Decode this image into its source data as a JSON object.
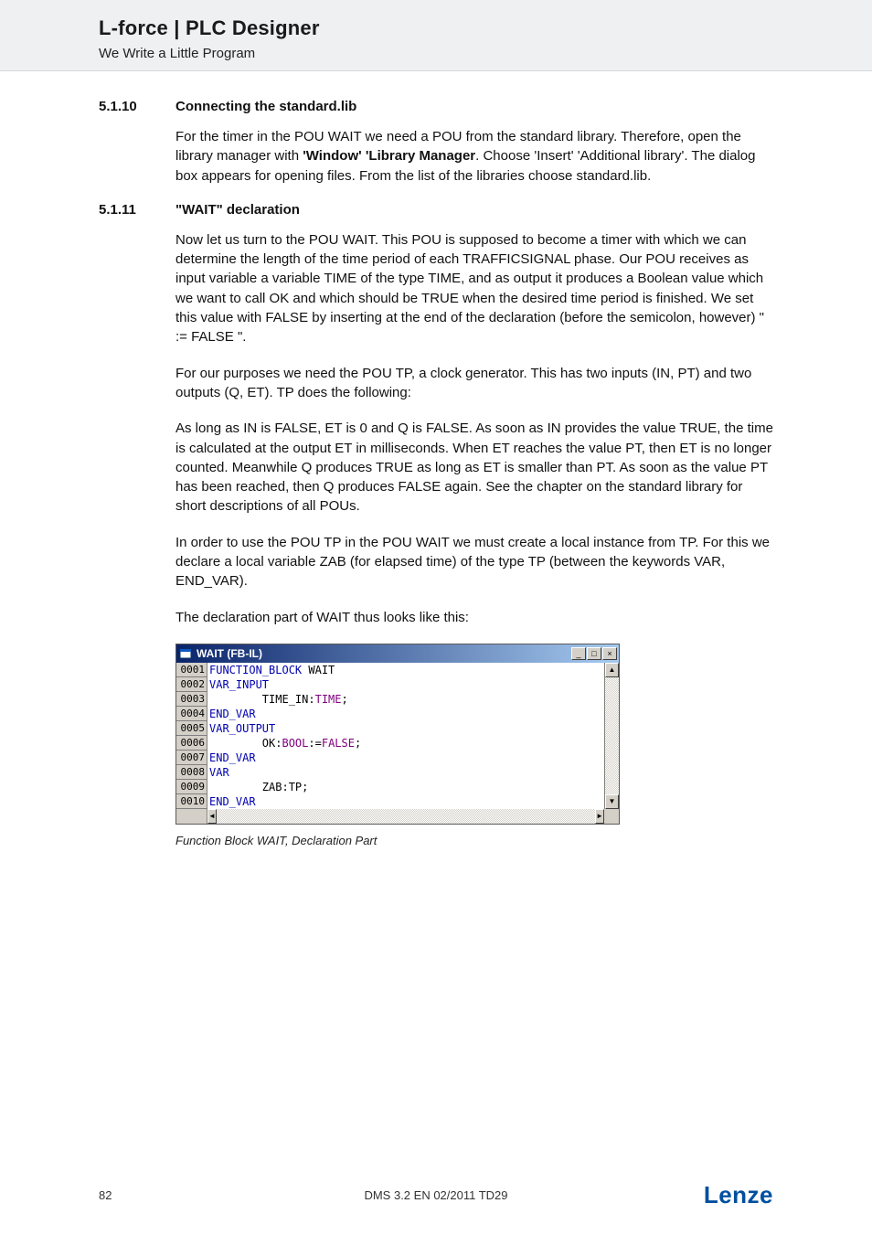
{
  "header": {
    "title": "L-force | PLC Designer",
    "subtitle": "We Write a Little Program"
  },
  "sections": [
    {
      "num": "5.1.10",
      "title": "Connecting the standard.lib",
      "paras": [
        {
          "pre": "For the timer in the POU WAIT we need a POU from the standard library. Therefore, open the library manager with ",
          "bold": "'Window' 'Library Manager",
          "post": ". Choose 'Insert' 'Additional library'. The dialog box appears for opening files. From the list of the libraries choose standard.lib."
        }
      ]
    },
    {
      "num": "5.1.11",
      "title": "\"WAIT\" declaration",
      "paras": [
        {
          "pre": "Now let us turn to the POU WAIT. This POU is supposed to become a timer with which we can determine the length of the time period of each TRAFFICSIGNAL phase. Our POU receives as input variable a variable TIME of the type TIME, and as output it produces a Boolean value which we want to call OK and which should be TRUE when the desired time period is finished. We set this value with FALSE by inserting at the end of the declaration (before the semicolon, however) \" := FALSE \".",
          "bold": "",
          "post": ""
        },
        {
          "pre": "For our purposes we need the POU TP, a clock generator. This has two inputs (IN, PT) and two outputs (Q, ET). TP does the following:",
          "bold": "",
          "post": ""
        },
        {
          "pre": "As long as IN is FALSE, ET is 0 and Q is FALSE. As soon as IN provides the value TRUE, the time is calculated at the output ET in milliseconds. When ET reaches the value PT, then ET is no longer counted. Meanwhile Q produces TRUE as long as ET is smaller than PT. As soon as the value PT has been reached, then Q produces FALSE again. See the chapter on the standard library for short descriptions of all POUs.",
          "bold": "",
          "post": ""
        },
        {
          "pre": "In order to use the POU TP in the POU WAIT we must create a local instance from TP. For this we declare a local variable ZAB (for elapsed time) of the type TP (between the keywords VAR, END_VAR).",
          "bold": "",
          "post": ""
        },
        {
          "pre": "The declaration part of WAIT thus looks like this:",
          "bold": "",
          "post": ""
        }
      ]
    }
  ],
  "codewin": {
    "title": "WAIT (FB-IL)",
    "lines": [
      {
        "n": "0001",
        "spans": [
          {
            "t": "FUNCTION_BLOCK",
            "c": "kw"
          },
          {
            "t": " WAIT",
            "c": "txt"
          }
        ]
      },
      {
        "n": "0002",
        "spans": [
          {
            "t": "VAR_INPUT",
            "c": "kw"
          }
        ]
      },
      {
        "n": "0003",
        "spans": [
          {
            "t": "        TIME_IN:",
            "c": "txt"
          },
          {
            "t": "TIME",
            "c": "ty"
          },
          {
            "t": ";",
            "c": "txt"
          }
        ]
      },
      {
        "n": "0004",
        "spans": [
          {
            "t": "END_VAR",
            "c": "kw"
          }
        ]
      },
      {
        "n": "0005",
        "spans": [
          {
            "t": "VAR_OUTPUT",
            "c": "kw"
          }
        ]
      },
      {
        "n": "0006",
        "spans": [
          {
            "t": "        OK:",
            "c": "txt"
          },
          {
            "t": "BOOL",
            "c": "ty"
          },
          {
            "t": ":=",
            "c": "txt"
          },
          {
            "t": "FALSE",
            "c": "ty"
          },
          {
            "t": ";",
            "c": "txt"
          }
        ]
      },
      {
        "n": "0007",
        "spans": [
          {
            "t": "END_VAR",
            "c": "kw"
          }
        ]
      },
      {
        "n": "0008",
        "spans": [
          {
            "t": "VAR",
            "c": "kw"
          }
        ]
      },
      {
        "n": "0009",
        "spans": [
          {
            "t": "        ZAB:TP;",
            "c": "txt"
          }
        ]
      },
      {
        "n": "0010",
        "spans": [
          {
            "t": "END_VAR",
            "c": "kw"
          }
        ]
      }
    ]
  },
  "caption": "Function Block WAIT, Declaration Part",
  "footer": {
    "page": "82",
    "docid": "DMS 3.2 EN 02/2011 TD29",
    "brand": "Lenze"
  }
}
